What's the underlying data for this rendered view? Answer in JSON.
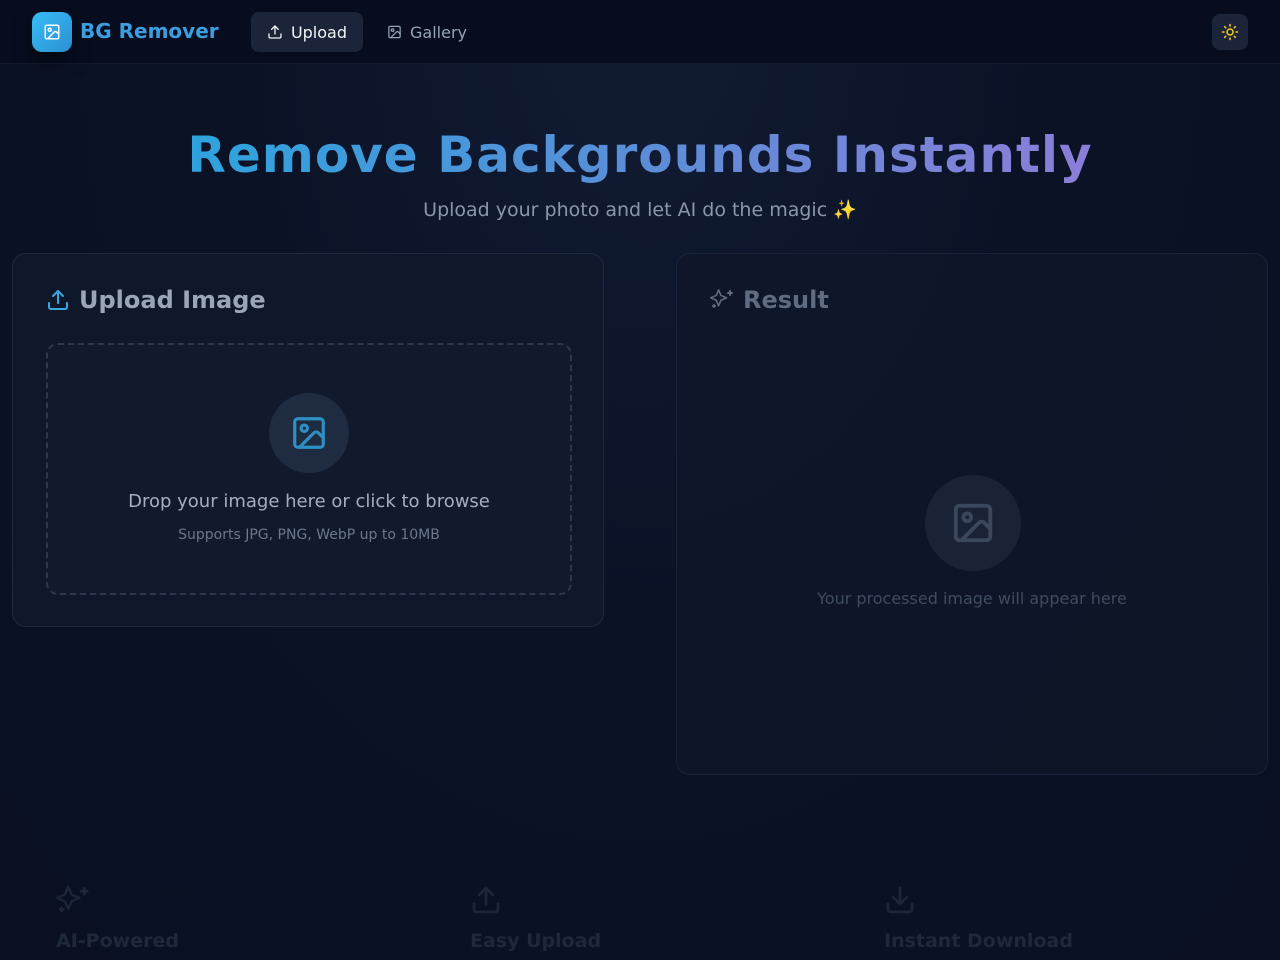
{
  "navbar": {
    "brand": "BG Remover",
    "logo_icon": "image-icon",
    "tabs": [
      {
        "label": "Upload",
        "icon": "upload-icon",
        "active": true
      },
      {
        "label": "Gallery",
        "icon": "image-icon",
        "active": false
      }
    ],
    "theme_icon": "sun-icon"
  },
  "hero": {
    "title": "Remove Backgrounds Instantly",
    "subtitle": "Upload your photo and let AI do the magic ✨"
  },
  "upload_card": {
    "title": "Upload Image",
    "title_icon": "upload-icon",
    "dropzone": {
      "icon": "image-icon",
      "text": "Drop your image here or click to browse",
      "subtext": "Supports JPG, PNG, WebP up to 10MB"
    }
  },
  "result_card": {
    "title": "Result",
    "title_icon": "sparkles-icon",
    "placeholder_icon": "image-icon",
    "placeholder_text": "Your processed image will appear here"
  },
  "features": [
    {
      "label": "AI-Powered",
      "icon": "sparkles-icon"
    },
    {
      "label": "Easy Upload",
      "icon": "upload-icon"
    },
    {
      "label": "Instant Download",
      "icon": "download-icon"
    }
  ],
  "colors": {
    "accent": "#3b9ee0",
    "gradient_start": "#2ea3dd",
    "gradient_end": "#8b7dd8",
    "background": "#0b1226"
  }
}
